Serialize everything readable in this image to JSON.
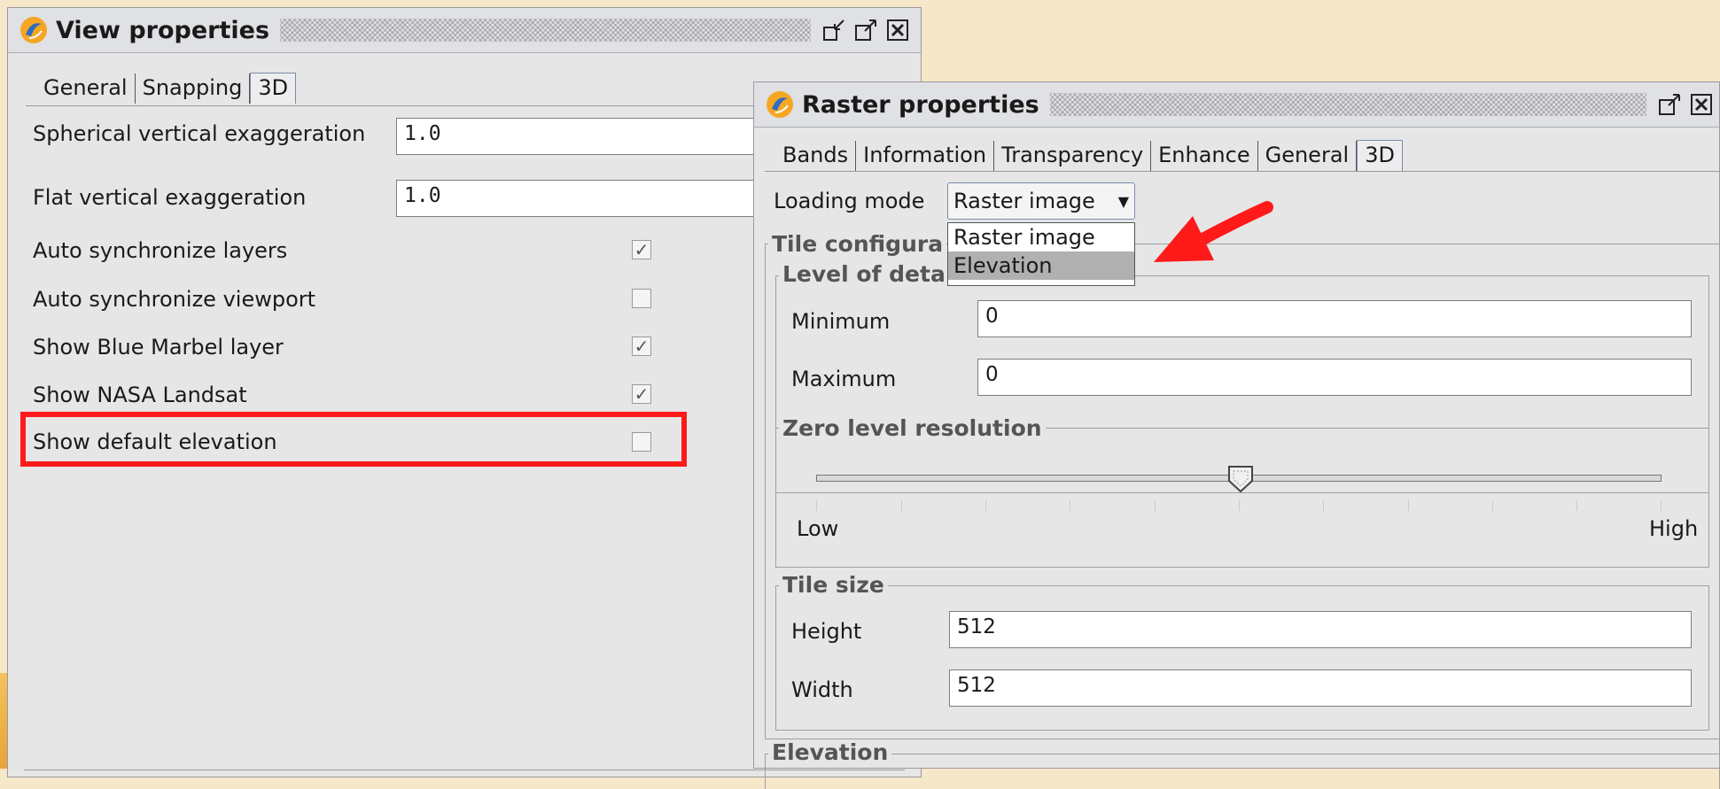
{
  "view_properties": {
    "title": "View properties",
    "tabs": [
      {
        "label": "General",
        "active": false
      },
      {
        "label": "Snapping",
        "active": false
      },
      {
        "label": "3D",
        "active": true
      }
    ],
    "fields": {
      "spherical_label": "Spherical vertical exaggeration",
      "spherical_value": "1.0",
      "flat_label": "Flat vertical exaggeration",
      "flat_value": "1.0"
    },
    "checks": [
      {
        "label": "Auto synchronize layers",
        "checked": true
      },
      {
        "label": "Auto synchronize viewport",
        "checked": false
      },
      {
        "label": "Show Blue Marbel layer",
        "checked": true
      },
      {
        "label": "Show NASA Landsat",
        "checked": true
      },
      {
        "label": "Show default elevation",
        "checked": false
      }
    ]
  },
  "raster_properties": {
    "title": "Raster properties",
    "tabs": [
      {
        "label": "Bands",
        "active": false
      },
      {
        "label": "Information",
        "active": false
      },
      {
        "label": "Transparency",
        "active": false
      },
      {
        "label": "Enhance",
        "active": false
      },
      {
        "label": "General",
        "active": false
      },
      {
        "label": "3D",
        "active": true
      }
    ],
    "loading_mode_label": "Loading mode",
    "loading_mode_value": "Raster image",
    "loading_mode_options": [
      {
        "label": "Raster image",
        "selected": false
      },
      {
        "label": "Elevation",
        "selected": true
      }
    ],
    "tile_config_title": "Tile configura",
    "level_of_detail_title": "Level of deta",
    "minimum_label": "Minimum",
    "minimum_value": "0",
    "maximum_label": "Maximum",
    "maximum_value": "0",
    "zero_level_title": "Zero level resolution",
    "slider_low": "Low",
    "slider_high": "High",
    "slider_level": 0.5,
    "tile_size_title": "Tile size",
    "height_label": "Height",
    "height_value": "512",
    "width_label": "Width",
    "width_value": "512",
    "elevation_title": "Elevation"
  },
  "colors": {
    "highlight": "#ff1a1a",
    "arrow": "#ff1a1a",
    "window_bg": "#e6e6e6"
  }
}
